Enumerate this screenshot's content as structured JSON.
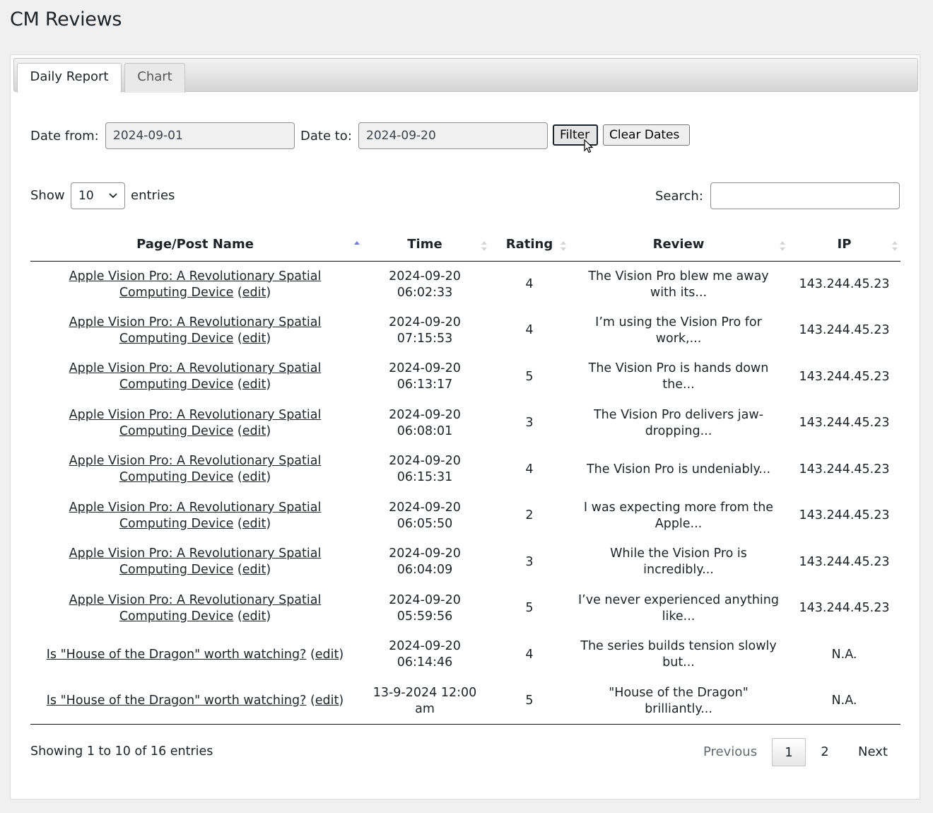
{
  "page": {
    "title": "CM Reviews"
  },
  "tabs": [
    {
      "label": "Daily Report"
    },
    {
      "label": "Chart"
    }
  ],
  "filter": {
    "date_from_label": "Date from:",
    "date_from_value": "2024-09-01",
    "date_to_label": "Date to:",
    "date_to_value": "2024-09-20",
    "filter_button": "Filter",
    "clear_button": "Clear Dates"
  },
  "length": {
    "show_label": "Show",
    "value": "10",
    "entries_label": "entries"
  },
  "search": {
    "label": "Search:",
    "value": ""
  },
  "table": {
    "columns": [
      "Page/Post Name",
      "Time",
      "Rating",
      "Review",
      "IP"
    ],
    "edit_label": "edit",
    "rows": [
      {
        "page": "Apple Vision Pro: A Revolutionary Spatial Computing Device",
        "time": "2024-09-20 06:02:33",
        "rating": "4",
        "review": "The Vision Pro blew me away with its...",
        "ip": "143.244.45.23"
      },
      {
        "page": "Apple Vision Pro: A Revolutionary Spatial Computing Device",
        "time": "2024-09-20 07:15:53",
        "rating": "4",
        "review": "I’m using the Vision Pro for work,...",
        "ip": "143.244.45.23"
      },
      {
        "page": "Apple Vision Pro: A Revolutionary Spatial Computing Device",
        "time": "2024-09-20 06:13:17",
        "rating": "5",
        "review": "The Vision Pro is hands down the...",
        "ip": "143.244.45.23"
      },
      {
        "page": "Apple Vision Pro: A Revolutionary Spatial Computing Device",
        "time": "2024-09-20 06:08:01",
        "rating": "3",
        "review": "The Vision Pro delivers jaw-dropping...",
        "ip": "143.244.45.23"
      },
      {
        "page": "Apple Vision Pro: A Revolutionary Spatial Computing Device",
        "time": "2024-09-20 06:15:31",
        "rating": "4",
        "review": "The Vision Pro is undeniably...",
        "ip": "143.244.45.23"
      },
      {
        "page": "Apple Vision Pro: A Revolutionary Spatial Computing Device",
        "time": "2024-09-20 06:05:50",
        "rating": "2",
        "review": "I was expecting more from the Apple...",
        "ip": "143.244.45.23"
      },
      {
        "page": "Apple Vision Pro: A Revolutionary Spatial Computing Device",
        "time": "2024-09-20 06:04:09",
        "rating": "3",
        "review": "While the Vision Pro is incredibly...",
        "ip": "143.244.45.23"
      },
      {
        "page": "Apple Vision Pro: A Revolutionary Spatial Computing Device",
        "time": "2024-09-20 05:59:56",
        "rating": "5",
        "review": "I’ve never experienced anything like...",
        "ip": "143.244.45.23"
      },
      {
        "page": "Is \"House of the Dragon\" worth watching?",
        "time": "2024-09-20 06:14:46",
        "rating": "4",
        "review": "The series builds tension slowly but...",
        "ip": "N.A."
      },
      {
        "page": "Is \"House of the Dragon\" worth watching?",
        "time": "13-9-2024 12:00 am",
        "rating": "5",
        "review": "\"House of the Dragon\" brilliantly...",
        "ip": "N.A."
      }
    ]
  },
  "info": "Showing 1 to 10 of 16 entries",
  "pagination": {
    "previous": "Previous",
    "pages": [
      "1",
      "2"
    ],
    "next": "Next"
  },
  "colors": {
    "sort_active": "#6f7fd6",
    "sort_inactive": "#d5d5d5"
  }
}
